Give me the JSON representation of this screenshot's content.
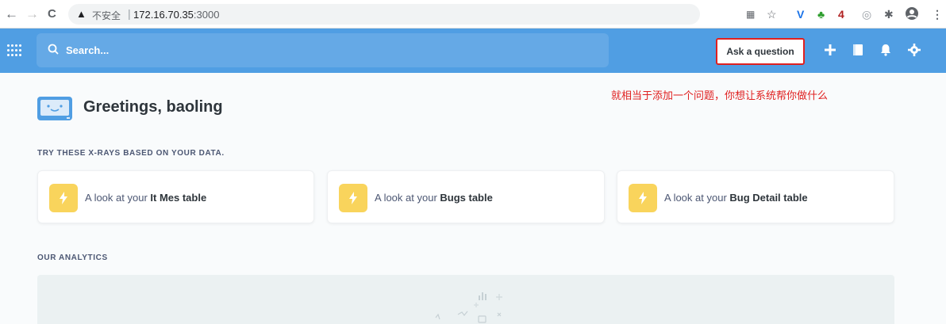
{
  "browser": {
    "back": "←",
    "forward": "→",
    "reload": "C",
    "insecure_label": "不安全",
    "separator": "|",
    "url_host": "172.16.70.35",
    "url_port": ":3000"
  },
  "nav": {
    "search_placeholder": "Search...",
    "ask_label": "Ask a question",
    "brand_color": "#509ee3"
  },
  "annotation": "就相当于添加一个问题，你想让系统帮你做什么",
  "greeting": {
    "title": "Greetings, baoling"
  },
  "xrays": {
    "heading": "TRY THESE X-RAYS BASED ON YOUR DATA.",
    "cards": [
      {
        "prefix": "A look at your ",
        "table": "It Mes table"
      },
      {
        "prefix": "A look at your ",
        "table": "Bugs table"
      },
      {
        "prefix": "A look at your ",
        "table": "Bug Detail table"
      }
    ]
  },
  "analytics": {
    "heading": "OUR ANALYTICS"
  }
}
